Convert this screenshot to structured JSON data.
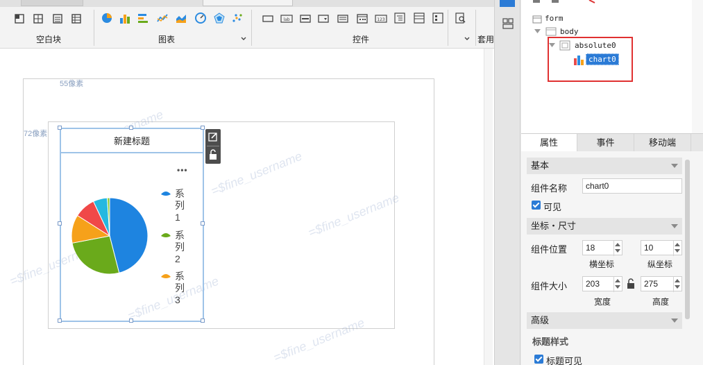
{
  "ribbon": {
    "groups": [
      {
        "label": "空白块"
      },
      {
        "label": "图表"
      },
      {
        "label": "控件"
      },
      {
        "label": "套用"
      }
    ]
  },
  "canvas": {
    "dim_top": "55像素",
    "dim_left": "72像素",
    "chart_title": "新建标题",
    "more_icon": "•••",
    "watermark": "=$fine_username",
    "legend": [
      {
        "label": "系列1",
        "color": "#1e84e0"
      },
      {
        "label": "系列2",
        "color": "#6aaa1b"
      },
      {
        "label": "系列3",
        "color": "#f6a11a"
      }
    ]
  },
  "chart_data": {
    "type": "pie",
    "slices": [
      {
        "name": "系列1",
        "value": 46,
        "color": "#1e84e0"
      },
      {
        "name": "系列2",
        "value": 26,
        "color": "#6aaa1b"
      },
      {
        "name": "系列3",
        "value": 12,
        "color": "#f6a11a"
      },
      {
        "name": "",
        "value": 9,
        "color": "#f04848"
      },
      {
        "name": "",
        "value": 6,
        "color": "#25b8e0"
      },
      {
        "name": "",
        "value": 1,
        "color": "#8acb2a"
      }
    ]
  },
  "tree": {
    "nodes": [
      {
        "label": "form"
      },
      {
        "label": "body"
      },
      {
        "label": "absolute0"
      },
      {
        "label": "chart0"
      }
    ]
  },
  "props": {
    "tabs": [
      {
        "label": "属性"
      },
      {
        "label": "事件"
      },
      {
        "label": "移动端"
      }
    ],
    "basic_header": "基本",
    "name_label": "组件名称",
    "name_value": "chart0",
    "visible_label": "可见",
    "coord_header": "坐标・尺寸",
    "pos_label": "组件位置",
    "pos_x": "18",
    "pos_y": "10",
    "x_caption": "横坐标",
    "y_caption": "纵坐标",
    "size_label": "组件大小",
    "width": "203",
    "height": "275",
    "w_caption": "宽度",
    "h_caption": "高度",
    "adv_header": "高级",
    "title_style": "标题样式",
    "title_visible": "标题可见"
  },
  "colors": {
    "selection": "#9ec3e8",
    "highlight": "#e03131",
    "accent": "#2b7bd6"
  }
}
